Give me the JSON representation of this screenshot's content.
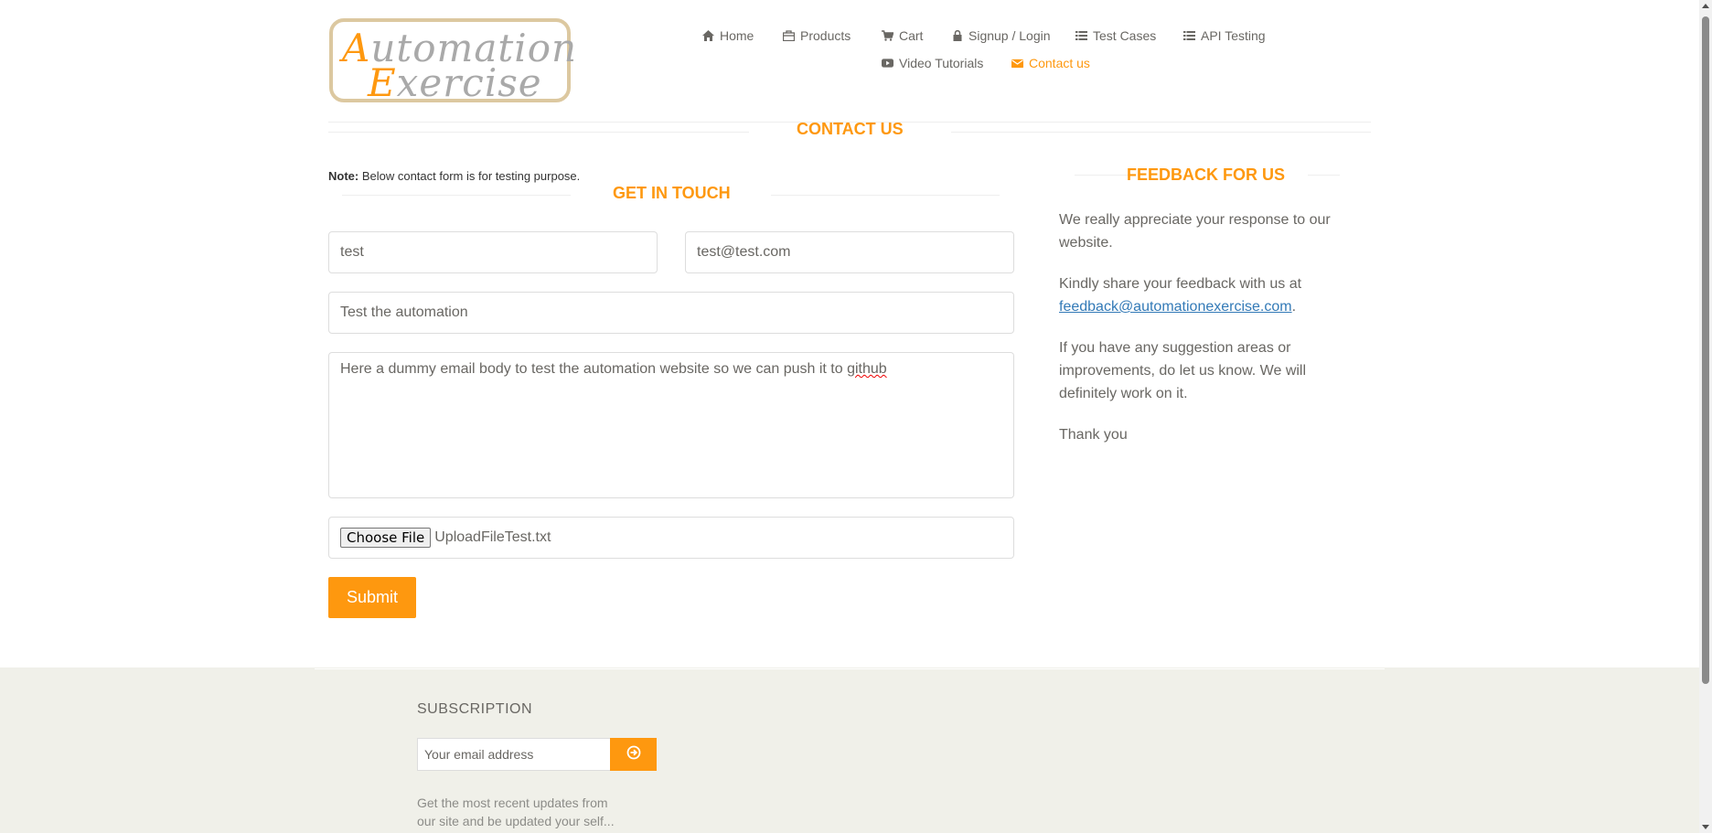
{
  "header": {
    "logo": {
      "line1_cap": "A",
      "line1_rest": "utomation",
      "line2_cap": "E",
      "line2_rest": "xercise"
    },
    "nav": [
      {
        "label": "Home",
        "icon": "home-icon"
      },
      {
        "label": "Products",
        "icon": "shopping-bag-icon"
      },
      {
        "label": "Cart",
        "icon": "cart-icon"
      },
      {
        "label": "Signup / Login",
        "icon": "lock-icon"
      },
      {
        "label": "Test Cases",
        "icon": "list-icon"
      },
      {
        "label": "API Testing",
        "icon": "list-icon"
      },
      {
        "label": "Video Tutorials",
        "icon": "youtube-play-icon"
      },
      {
        "label": "Contact us",
        "icon": "envelope-icon",
        "active": true
      }
    ]
  },
  "contact": {
    "title": "CONTACT US",
    "note_label": "Note:",
    "note_text": " Below contact form is for testing purpose.",
    "get_in_touch": "GET IN TOUCH",
    "form": {
      "name_value": "test",
      "email_value": "test@test.com",
      "subject_value": "Test the automation",
      "message_prefix": "Here a dummy email body to test the automation website so we can push it to ",
      "message_misspelled": "github",
      "file_button": "Choose File",
      "file_name": "UploadFileTest.txt",
      "submit_label": "Submit"
    }
  },
  "feedback": {
    "title": "FEEDBACK FOR US",
    "p1": "We really appreciate your response to our website.",
    "p2_text": "Kindly share your feedback with us at ",
    "p2_link": "feedback@automationexercise.com",
    "p2_end": ".",
    "p3": "If you have any suggestion areas or improvements, do let us know. We will definitely work on it.",
    "p4": "Thank you"
  },
  "footer": {
    "subscription_title": "SUBSCRIPTION",
    "email_placeholder": "Your email address",
    "description": "Get the most recent updates from our site and be updated your self..."
  },
  "colors": {
    "accent": "#FE980F",
    "text": "#696763",
    "link": "#337AB7",
    "footer_bg": "#F0F0E9"
  }
}
